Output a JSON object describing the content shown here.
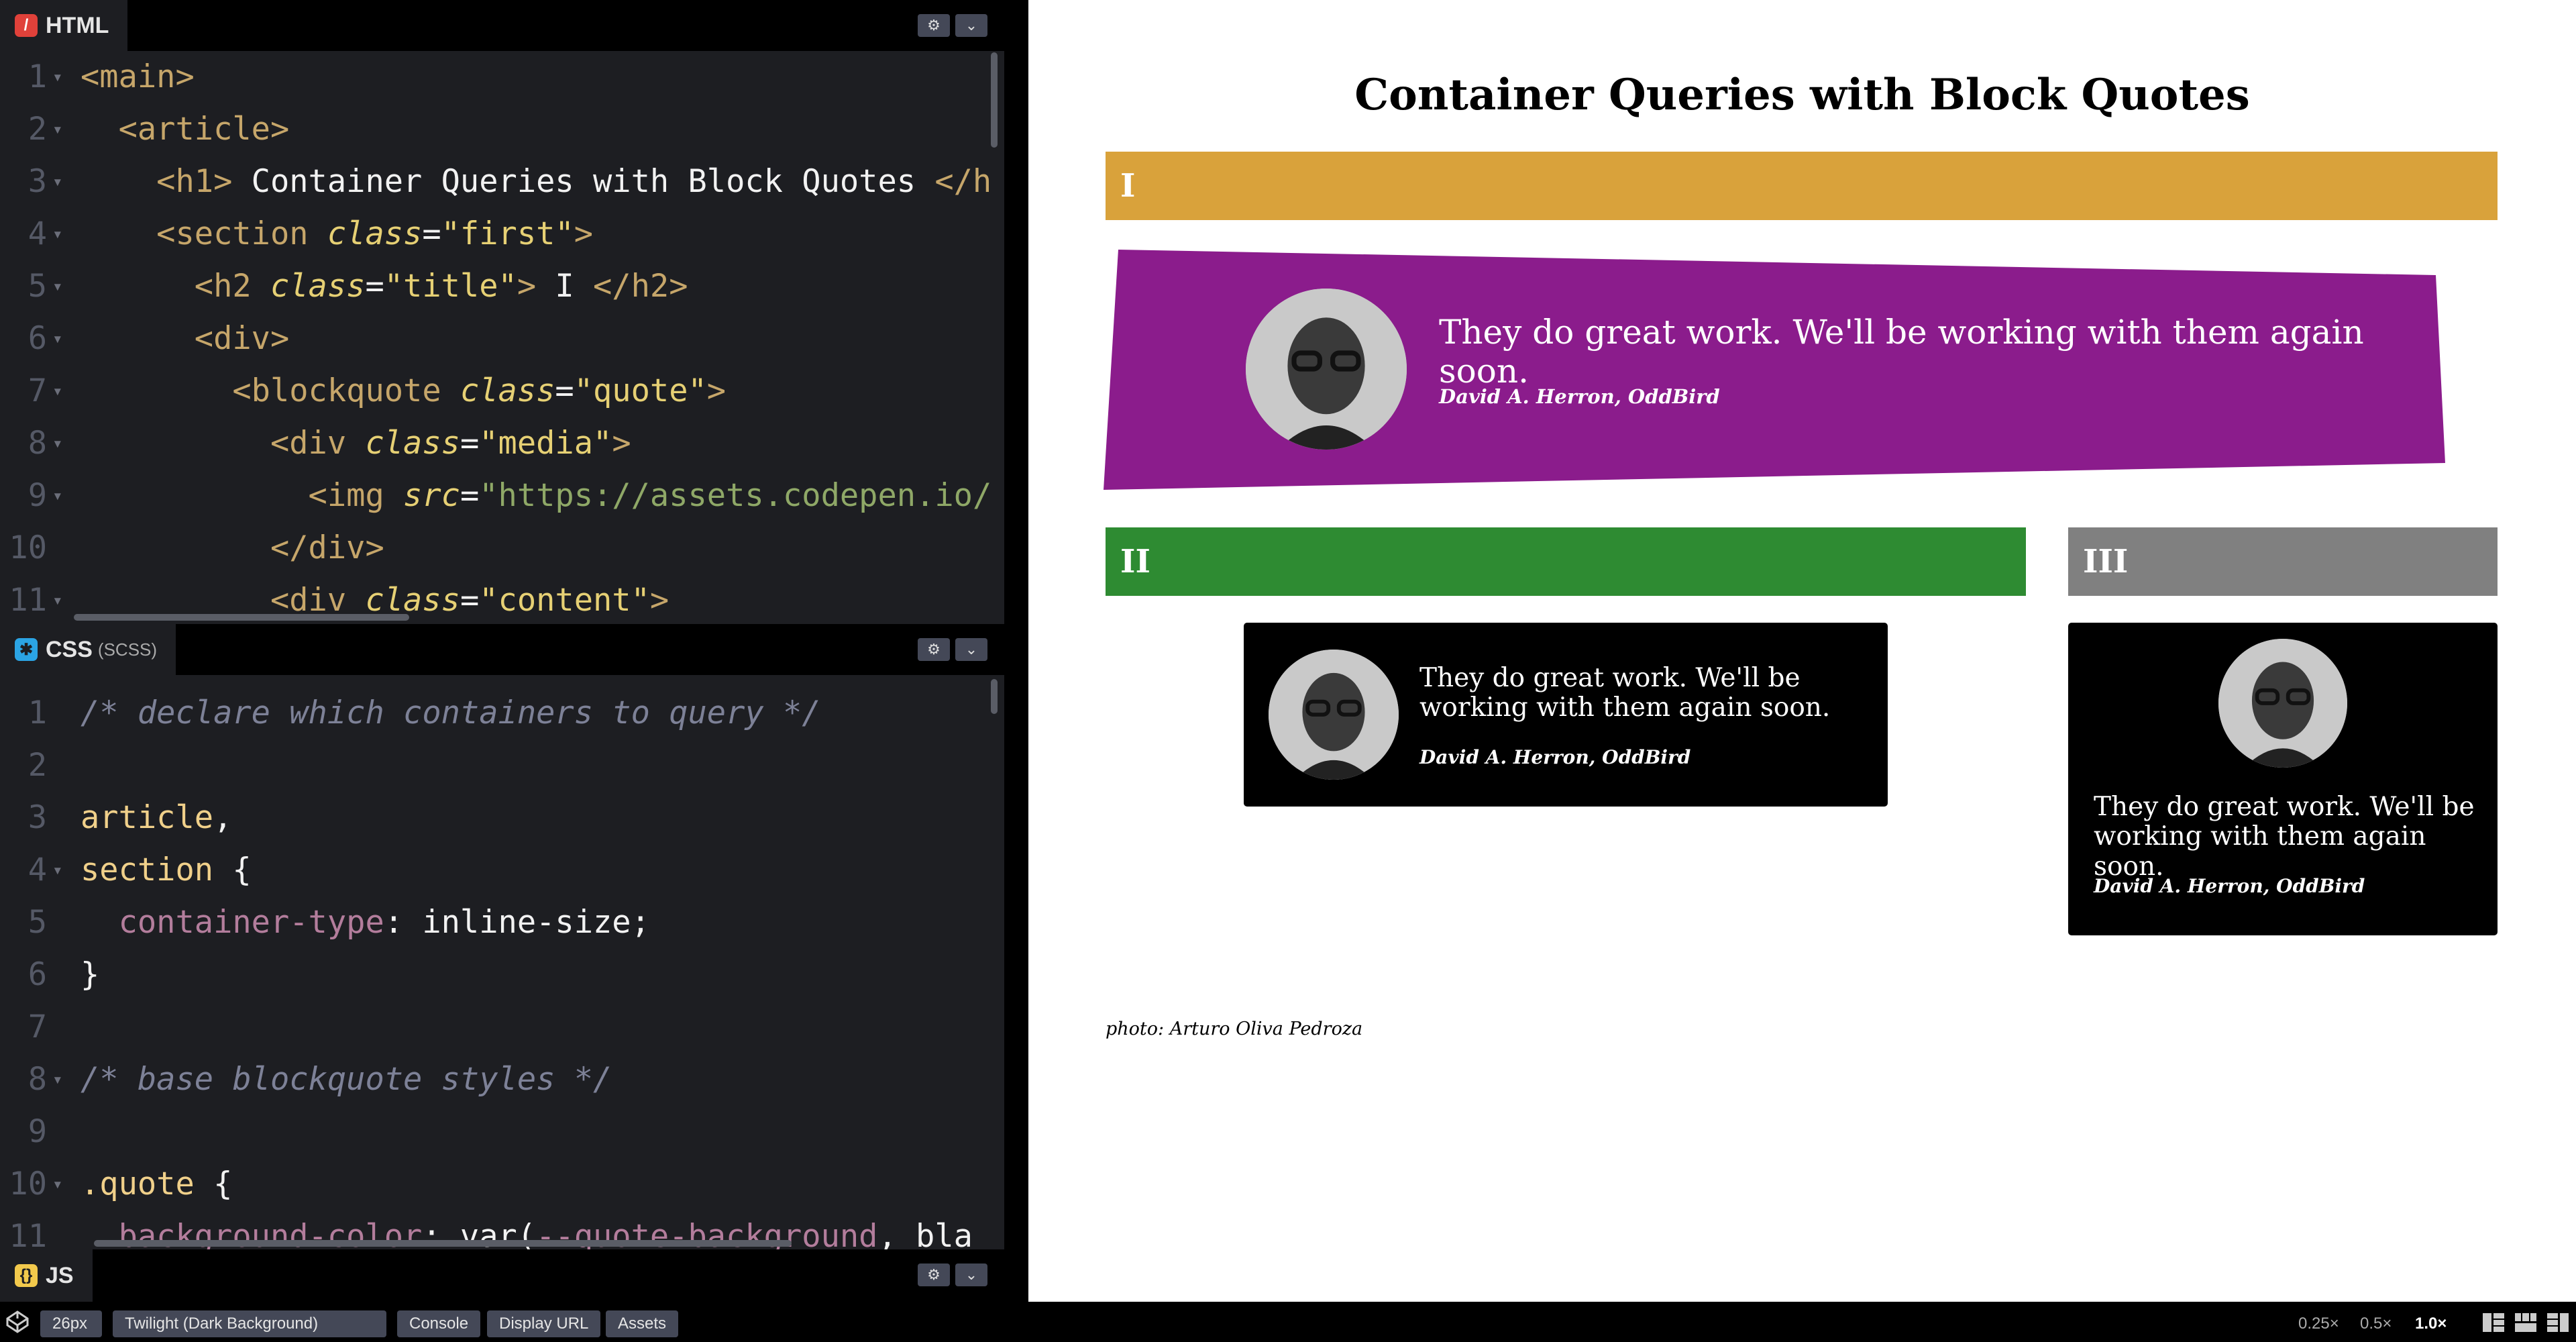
{
  "html_pane": {
    "title": "HTML",
    "lines": [
      {
        "n": "1",
        "parts": [
          [
            "tg",
            "<main>"
          ]
        ]
      },
      {
        "n": "2",
        "parts": [
          [
            "tg",
            "  <article>"
          ]
        ]
      },
      {
        "n": "3",
        "parts": [
          [
            "tg",
            "    <h1>"
          ],
          [
            "pl",
            " Container Queries with Block Quotes "
          ],
          [
            "tg",
            "</h"
          ]
        ]
      },
      {
        "n": "4",
        "parts": [
          [
            "tg",
            "    <section "
          ],
          [
            "at",
            "class"
          ],
          [
            "pl",
            "="
          ],
          [
            "st",
            "\"first\""
          ],
          [
            "tg",
            ">"
          ]
        ]
      },
      {
        "n": "5",
        "parts": [
          [
            "tg",
            "      <h2 "
          ],
          [
            "at",
            "class"
          ],
          [
            "pl",
            "="
          ],
          [
            "st",
            "\"title\""
          ],
          [
            "tg",
            ">"
          ],
          [
            "pl",
            " I "
          ],
          [
            "tg",
            "</h2>"
          ]
        ]
      },
      {
        "n": "6",
        "parts": [
          [
            "tg",
            "      <div>"
          ]
        ]
      },
      {
        "n": "7",
        "parts": [
          [
            "tg",
            "        <blockquote "
          ],
          [
            "at",
            "class"
          ],
          [
            "pl",
            "="
          ],
          [
            "st",
            "\"quote\""
          ],
          [
            "tg",
            ">"
          ]
        ]
      },
      {
        "n": "8",
        "parts": [
          [
            "tg",
            "          <div "
          ],
          [
            "at",
            "class"
          ],
          [
            "pl",
            "="
          ],
          [
            "st",
            "\"media\""
          ],
          [
            "tg",
            ">"
          ]
        ]
      },
      {
        "n": "9",
        "parts": [
          [
            "tg",
            "            <img "
          ],
          [
            "at",
            "src"
          ],
          [
            "pl",
            "="
          ],
          [
            "sl",
            "\"https://assets.codepen.io/"
          ]
        ]
      },
      {
        "n": "10",
        "parts": [
          [
            "tg",
            "          </div>"
          ]
        ]
      },
      {
        "n": "11",
        "parts": [
          [
            "tg",
            "          <div "
          ],
          [
            "at",
            "class"
          ],
          [
            "pl",
            "="
          ],
          [
            "st",
            "\"content\""
          ],
          [
            "tg",
            ">"
          ]
        ]
      }
    ]
  },
  "css_pane": {
    "title": "CSS",
    "subtitle": "(SCSS)",
    "lines": [
      {
        "n": "1",
        "parts": [
          [
            "cm",
            "/* declare which containers to query */"
          ]
        ]
      },
      {
        "n": "2",
        "parts": []
      },
      {
        "n": "3",
        "parts": [
          [
            "sel",
            "article"
          ],
          [
            "pl",
            ","
          ]
        ]
      },
      {
        "n": "4",
        "parts": [
          [
            "sel",
            "section"
          ],
          [
            "pl",
            " {"
          ]
        ]
      },
      {
        "n": "5",
        "parts": [
          [
            "prop",
            "  container-type"
          ],
          [
            "pl",
            ": inline-size;"
          ]
        ]
      },
      {
        "n": "6",
        "parts": [
          [
            "pl",
            "}"
          ]
        ]
      },
      {
        "n": "7",
        "parts": []
      },
      {
        "n": "8",
        "parts": [
          [
            "cm",
            "/* base blockquote styles */"
          ]
        ]
      },
      {
        "n": "9",
        "parts": []
      },
      {
        "n": "10",
        "parts": [
          [
            "sel",
            ".quote"
          ],
          [
            "pl",
            " {"
          ]
        ]
      },
      {
        "n": "11",
        "parts": [
          [
            "prop",
            "  background-color"
          ],
          [
            "pl",
            ": var("
          ],
          [
            "prop",
            "--quote-background"
          ],
          [
            "pl",
            ", bla"
          ]
        ]
      }
    ]
  },
  "js_pane": {
    "title": "JS"
  },
  "preview": {
    "title": "Container Queries with Block Quotes",
    "sections": {
      "first": {
        "label": "I",
        "color": "#d9a23b"
      },
      "second": {
        "label": "II",
        "color": "#2e8b32"
      },
      "third": {
        "label": "III",
        "color": "#808080"
      }
    },
    "quote": {
      "text": "They do great work. We'll be working with them again soon.",
      "text_line1": "They do great work. We'll be",
      "text_line2": "working with them again soon.",
      "cite": "David A. Herron, OddBird"
    },
    "quote_colors": {
      "first_bg": "#8b1c8c",
      "small_bg": "#000000"
    },
    "photo_credit": "photo: Arturo Oliva Pedroza"
  },
  "footer": {
    "font_size": "26px",
    "theme": "Twilight (Dark Background)",
    "console": "Console",
    "display_url": "Display URL",
    "assets": "Assets",
    "zooms": [
      "0.25×",
      "0.5×",
      "1.0×"
    ]
  }
}
